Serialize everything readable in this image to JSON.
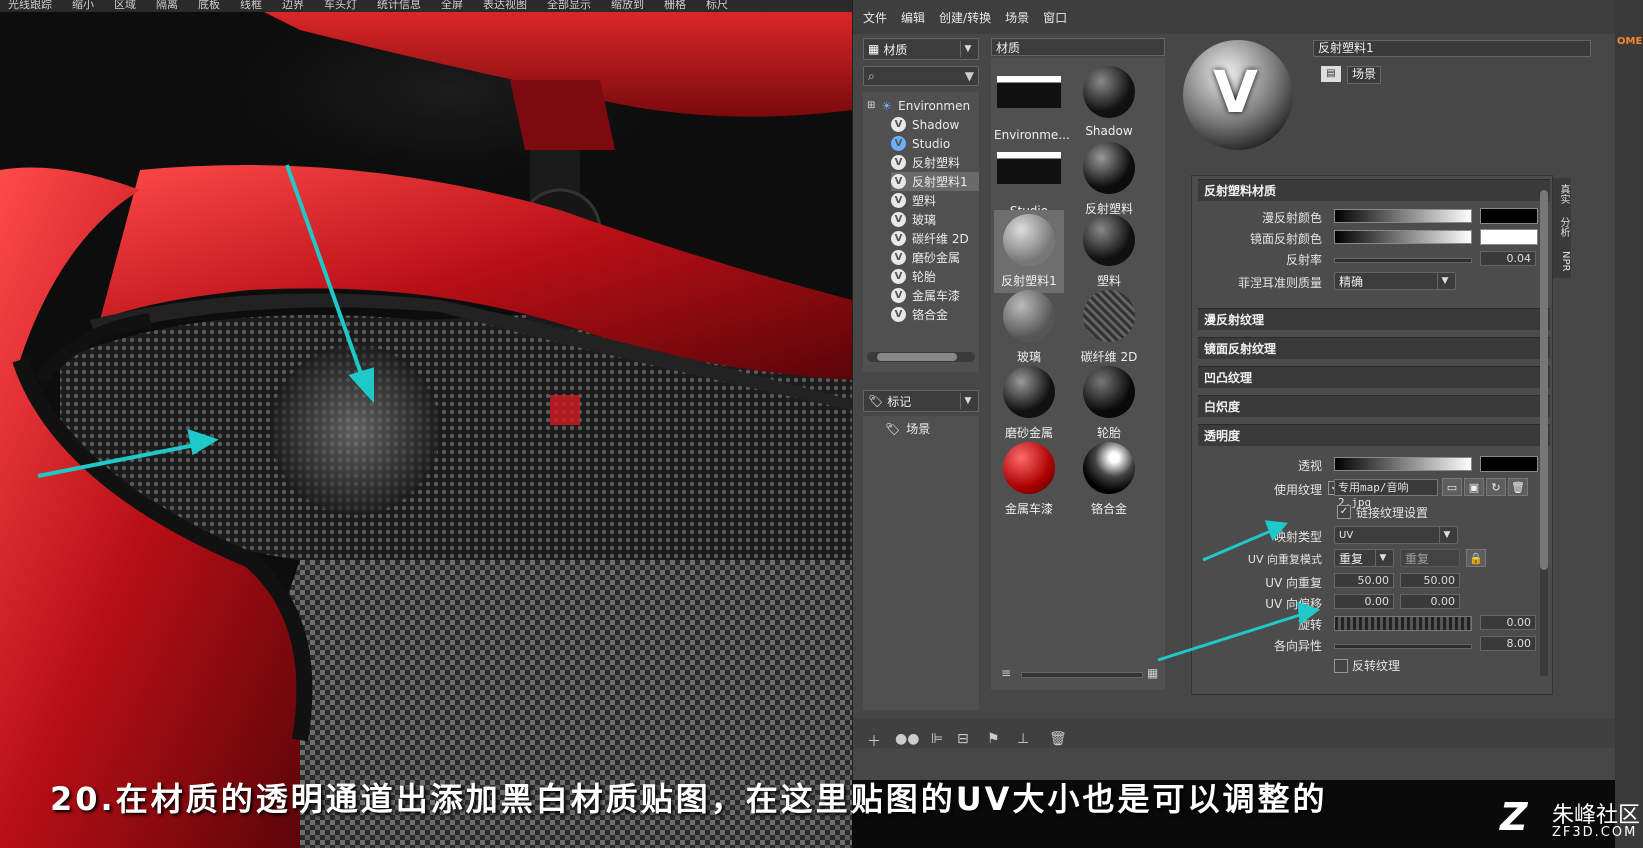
{
  "viewport": {
    "toolbar": [
      "光线跟踪",
      "缩小",
      "区域",
      "隔离",
      "底板",
      "线框",
      "边界",
      "车头灯",
      "统计信息",
      "全屏",
      "表达视图",
      "全部显示",
      "缩放到",
      "栅格",
      "标尺"
    ]
  },
  "menubar": [
    "文件",
    "编辑",
    "创建/转换",
    "场景",
    "窗口"
  ],
  "library": {
    "combo_label": "材质",
    "tree": [
      {
        "label": "Environmen",
        "icon": "environment-icon"
      },
      {
        "label": "Shadow",
        "icon": "material-v-icon"
      },
      {
        "label": "Studio",
        "icon": "studio-icon"
      },
      {
        "label": "反射塑料",
        "icon": "material-v-icon"
      },
      {
        "label": "反射塑料1",
        "icon": "material-v-icon"
      },
      {
        "label": "塑料",
        "icon": "material-v-icon"
      },
      {
        "label": "玻璃",
        "icon": "material-v-icon"
      },
      {
        "label": "碳纤维 2D",
        "icon": "material-v-icon"
      },
      {
        "label": "磨砂金属",
        "icon": "material-v-icon"
      },
      {
        "label": "轮胎",
        "icon": "material-v-icon"
      },
      {
        "label": "金属车漆",
        "icon": "material-v-icon"
      },
      {
        "label": "铬合金",
        "icon": "material-v-icon"
      }
    ],
    "tags_combo": "标记",
    "tags_tree_item": "场景"
  },
  "gallery": {
    "header": "材质",
    "items": [
      "Environme...",
      "Shadow",
      "Studio",
      "反射塑料",
      "反射塑料1",
      "塑料",
      "玻璃",
      "碳纤维 2D",
      "磨砂金属",
      "轮胎",
      "金属车漆",
      "铬合金"
    ]
  },
  "editor": {
    "material_name": "反射塑料1",
    "tag": "场景",
    "sections": {
      "main": "反射塑料材质",
      "diffuse_tex": "漫反射纹理",
      "specular_tex": "镜面反射纹理",
      "bump_tex": "凹凸纹理",
      "incandescence": "白炽度",
      "transparency": "透明度"
    },
    "props": {
      "diffuse_color": "漫反射颜色",
      "specular_color": "镜面反射颜色",
      "reflectivity": "反射率",
      "reflectivity_value": "0.04",
      "fresnel": "菲涅耳准则质量",
      "fresnel_value": "精确",
      "transparency": "透视",
      "use_texture": "使用纹理",
      "texture_path": "专用map/音响2.jpg",
      "link_texture": "链接纹理设置",
      "mapping_type": "映射类型",
      "mapping_value": "UV",
      "uv_mode": "UV 向重复模式",
      "uv_mode_value": "重复",
      "uv_mode_value2": "重复",
      "uv_repeat": "UV 向重复",
      "uv_repeat_u": "50.00",
      "uv_repeat_v": "50.00",
      "uv_offset": "UV 向偏移",
      "uv_offset_u": "0.00",
      "uv_offset_v": "0.00",
      "rotation": "旋转",
      "rotation_value": "0.00",
      "anisotropy": "各向异性",
      "anisotropy_value": "8.00",
      "invert": "反转纹理"
    },
    "sidetabs": [
      "真实",
      "分析",
      "NPR"
    ]
  },
  "caption": "20.在材质的透明通道出添加黑白材质贴图，在这里贴图的UV大小也是可以调整的",
  "logo": {
    "mark": "Z",
    "name": "朱峰社区",
    "url": "ZF3D.COM"
  },
  "corner_text": "OME",
  "colors": {
    "arrow": "#1fc9c9",
    "car_red": "#c4121a",
    "panel": "#474747",
    "section": "#3a3a3a"
  }
}
